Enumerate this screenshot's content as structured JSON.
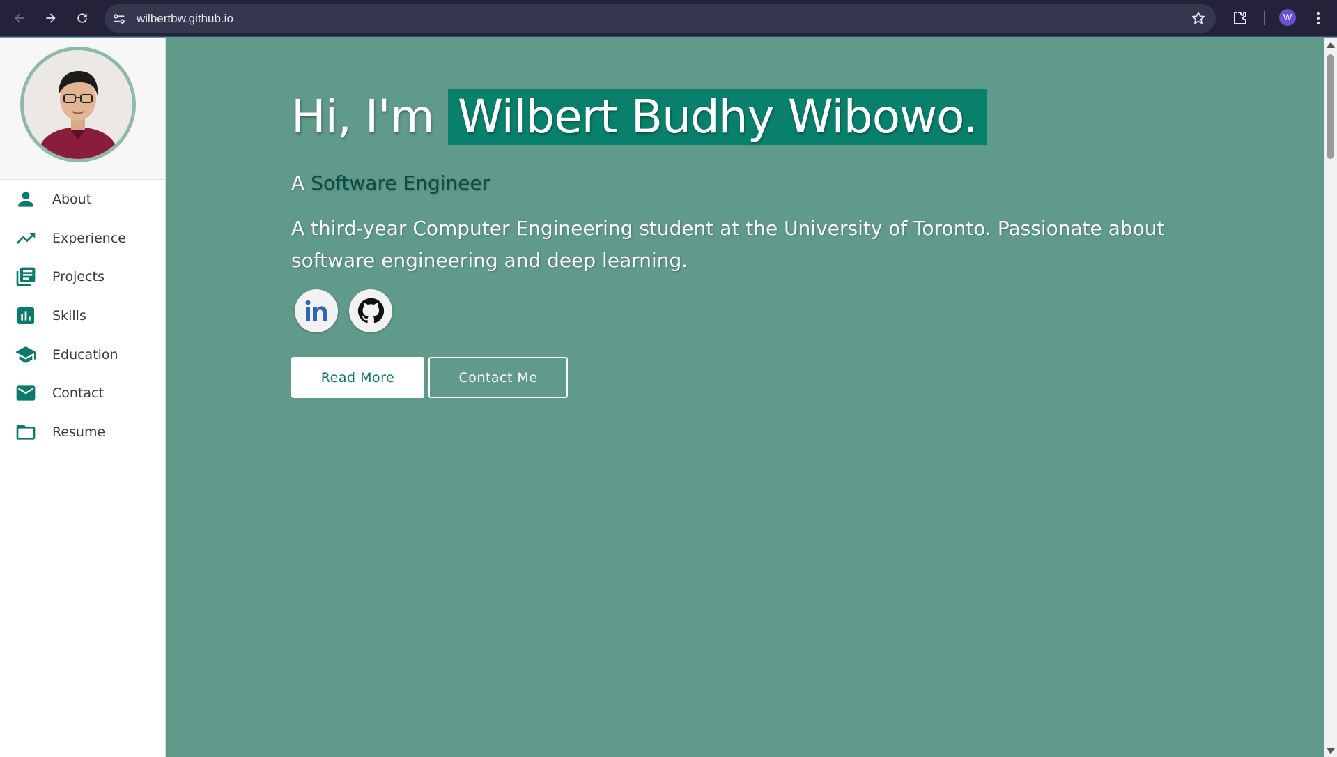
{
  "browser": {
    "url": "wilbertbw.github.io",
    "profile_initial": "W"
  },
  "sidebar": {
    "items": [
      {
        "label": "About",
        "icon": "person-icon"
      },
      {
        "label": "Experience",
        "icon": "trending-up-icon"
      },
      {
        "label": "Projects",
        "icon": "library-books-icon"
      },
      {
        "label": "Skills",
        "icon": "bar-chart-icon"
      },
      {
        "label": "Education",
        "icon": "school-icon"
      },
      {
        "label": "Contact",
        "icon": "mail-icon"
      },
      {
        "label": "Resume",
        "icon": "folder-icon"
      }
    ]
  },
  "hero": {
    "greeting": "Hi, I'm",
    "name": "Wilbert Budhy Wibowo.",
    "tagline_prefix": "A",
    "role": "Software Engineer",
    "bio": "A third-year Computer Engineering student at the University of Toronto. Passionate about software engineering and deep learning.",
    "read_more_label": "Read More",
    "contact_label": "Contact Me"
  },
  "colors": {
    "hero_background": "#5f9a8b",
    "accent": "#0a7a6a",
    "name_highlight": "#09806c"
  }
}
